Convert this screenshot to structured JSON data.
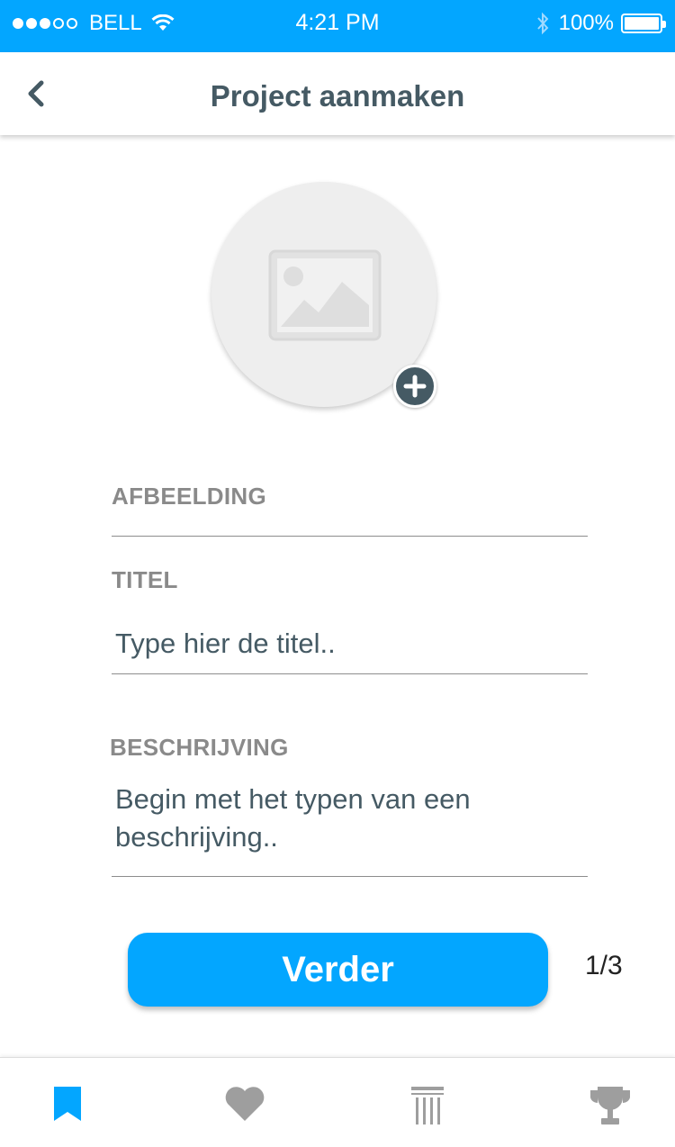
{
  "status_bar": {
    "carrier": "BELL",
    "time": "4:21 PM",
    "battery": "100%"
  },
  "header": {
    "title": "Project aanmaken"
  },
  "form": {
    "image_label": "AFBEELDING",
    "title_label": "TITEL",
    "title_placeholder": "Type hier de titel..",
    "description_label": "BESCHRIJVING",
    "description_placeholder": "Begin met het typen van een beschrijving.."
  },
  "actions": {
    "next_label": "Verder",
    "step_indicator": "1/3"
  },
  "tabs": [
    {
      "icon": "bookmark-icon",
      "active": true
    },
    {
      "icon": "heart-icon",
      "active": false
    },
    {
      "icon": "columns-icon",
      "active": false
    },
    {
      "icon": "trophy-icon",
      "active": false
    }
  ],
  "colors": {
    "accent": "#03a6ff",
    "text_dark": "#455a64",
    "label_gray": "#8a8a8a",
    "tab_inactive": "#9e9e9e"
  }
}
